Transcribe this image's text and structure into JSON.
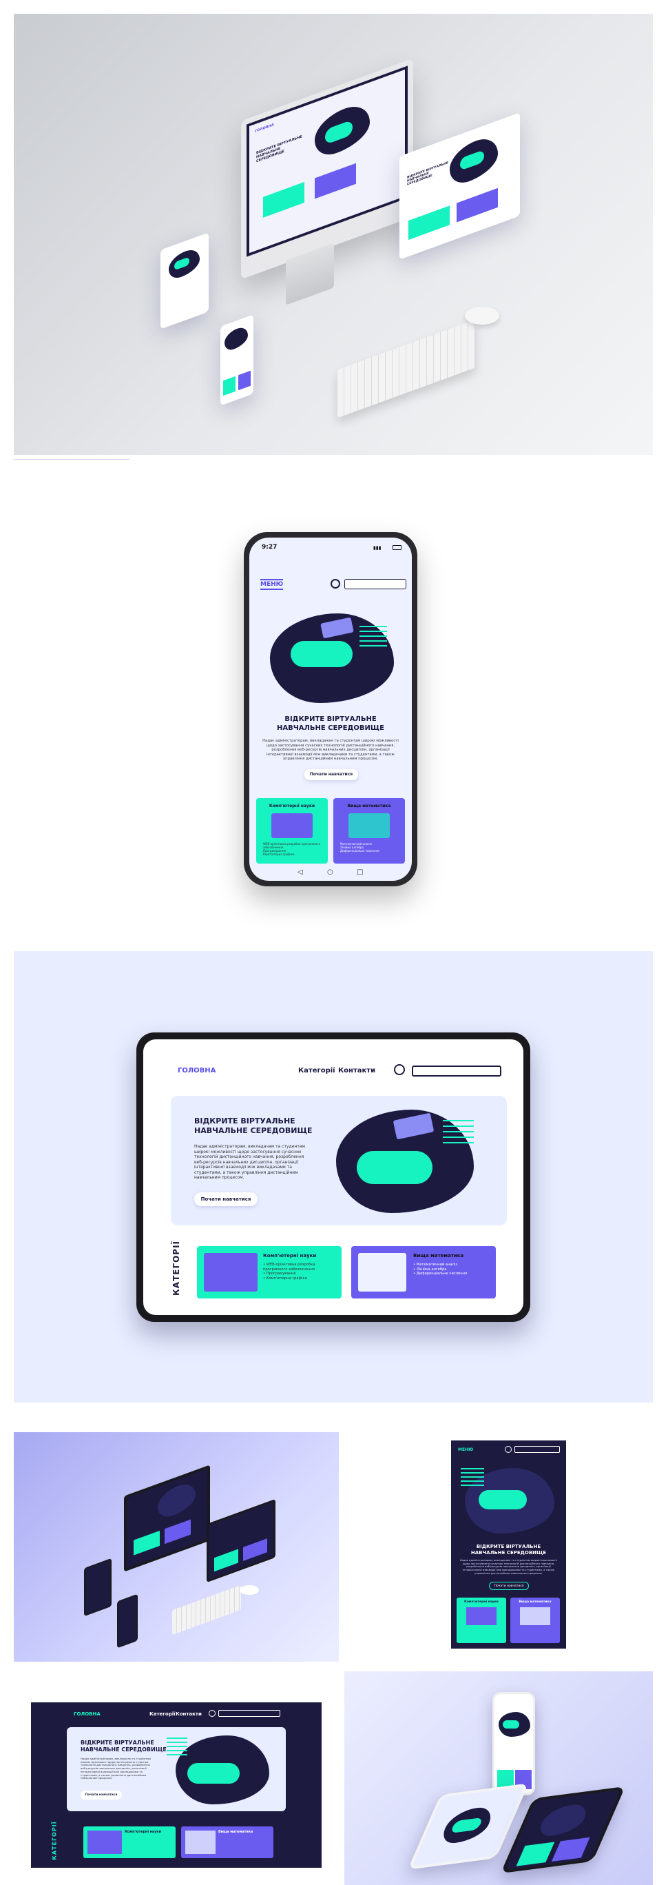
{
  "status_bar": {
    "time": "9:27"
  },
  "nav": {
    "menu": "МЕНЮ",
    "home": "ГОЛОВНА",
    "categories": "Категорії",
    "contacts": "Контакти"
  },
  "hero": {
    "title_line1": "ВІДКРИТЕ ВІРТУАЛЬНЕ",
    "title_line2": "НАВЧАЛЬНЕ СЕРЕДОВИЩЕ",
    "body": "Надає адміністраторам, викладачам та студентам широкі можливості щодо застосування сучасних технологій дистанційного навчання, розроблення веб-ресурсів навчальних дисциплін, організації інтерактивної взаємодії між викладачами та студентами, а також управління дистанційним навчальним процесом.",
    "cta": "Почати навчатися"
  },
  "categories": {
    "heading": "КАТЕГОРІЇ",
    "cards": [
      {
        "title": "Комп'ютерні науки",
        "items": [
          "WEB-орієнтовна розробка програмного забезпечення",
          "Програмування",
          "Комп'ютерна графіка"
        ]
      },
      {
        "title": "Вища математика",
        "items": [
          "Математичний аналіз",
          "Лінійна алгебра",
          "Диференціальне числення"
        ]
      }
    ]
  },
  "colors": {
    "teal": "#16f2c0",
    "indigo": "#6b5cf0",
    "navy": "#1d1a40",
    "accent": "#5a4fe6",
    "lavender": "#e8edff"
  }
}
